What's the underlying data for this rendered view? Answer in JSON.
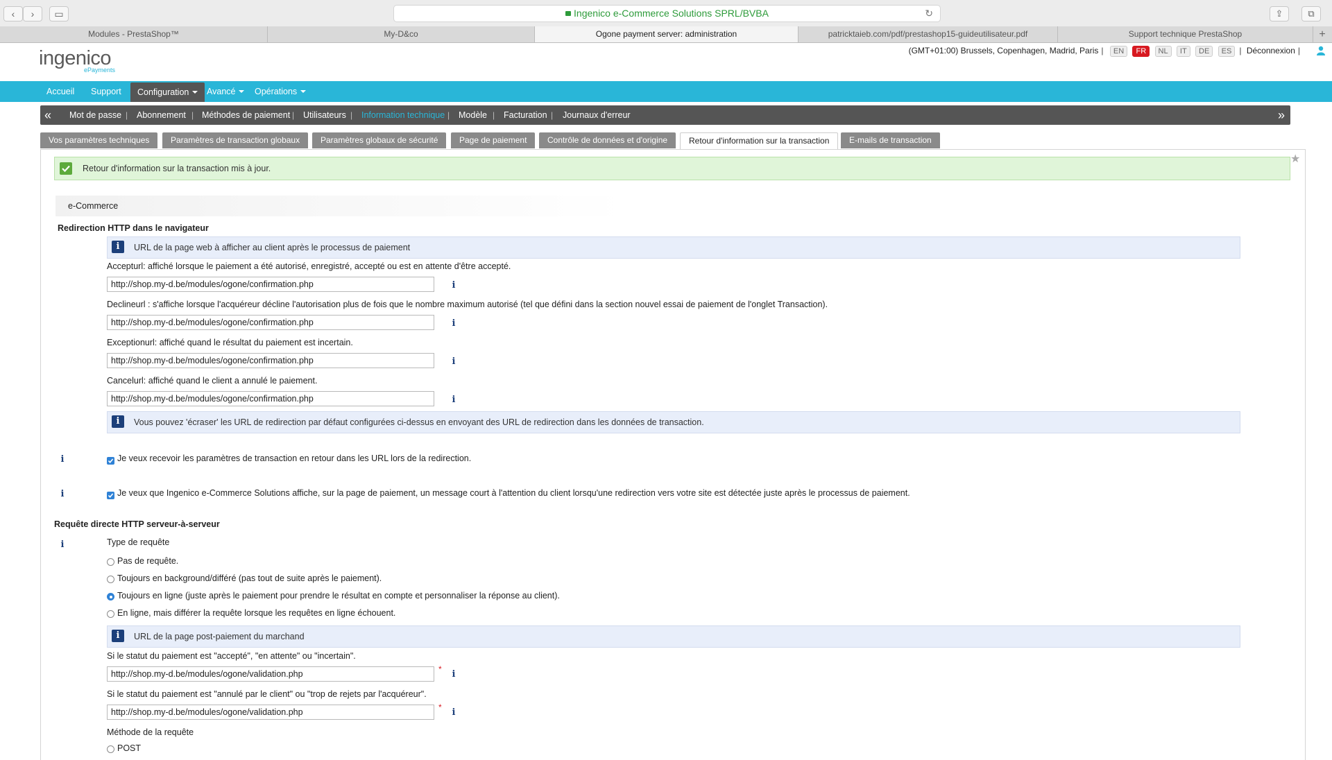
{
  "browser": {
    "url_text": "Ingenico e-Commerce Solutions SPRL/BVBA",
    "tabs": [
      {
        "label": "Modules - PrestaShop™"
      },
      {
        "label": "My-D&co"
      },
      {
        "label": "Ogone payment server: administration"
      },
      {
        "label": "patricktaieb.com/pdf/prestashop15-guideutilisateur.pdf"
      },
      {
        "label": "Support technique PrestaShop"
      }
    ],
    "new_tab": "+"
  },
  "header": {
    "logo_text": "ingenico",
    "logo_sub": "ePayments",
    "timezone": "(GMT+01:00) Brussels, Copenhagen, Madrid, Paris",
    "languages": [
      "EN",
      "FR",
      "NL",
      "IT",
      "DE",
      "ES"
    ],
    "active_language": "FR",
    "logout": "Déconnexion"
  },
  "mainmenu": {
    "items": [
      {
        "label": "Accueil"
      },
      {
        "label": "Support"
      },
      {
        "label": "Configuration"
      },
      {
        "label": "Avancé"
      },
      {
        "label": "Opérations"
      }
    ]
  },
  "submenu": {
    "items": [
      {
        "label": "Mot de passe"
      },
      {
        "label": "Abonnement"
      },
      {
        "label": "Méthodes de paiement"
      },
      {
        "label": "Utilisateurs"
      },
      {
        "label": "Information technique"
      },
      {
        "label": "Modèle"
      },
      {
        "label": "Facturation"
      },
      {
        "label": "Journaux d'erreur"
      }
    ]
  },
  "content_tabs": [
    {
      "label": "Vos paramètres techniques"
    },
    {
      "label": "Paramètres de transaction globaux"
    },
    {
      "label": "Paramètres globaux de sécurité"
    },
    {
      "label": "Page de paiement"
    },
    {
      "label": "Contrôle de données et d'origine"
    },
    {
      "label": "Retour d'information sur la transaction"
    },
    {
      "label": "E-mails de transaction"
    }
  ],
  "success_message": "Retour d'information sur la transaction mis à jour.",
  "section_title": "e-Commerce",
  "redirect": {
    "heading": "Redirection HTTP dans le navigateur",
    "info": "URL de la page web à afficher au client après le processus de paiement",
    "accept_label": "Accepturl: affiché lorsque le paiement a été autorisé, enregistré, accepté ou est en attente d'être accepté.",
    "accept_value": "http://shop.my-d.be/modules/ogone/confirmation.php",
    "decline_label": "Declineurl : s'affiche lorsque l'acquéreur décline l'autorisation plus de fois que le nombre maximum autorisé (tel que défini dans la section nouvel essai de paiement de l'onglet Transaction).",
    "decline_value": "http://shop.my-d.be/modules/ogone/confirmation.php",
    "exception_label": "Exceptionurl: affiché quand le résultat du paiement est incertain.",
    "exception_value": "http://shop.my-d.be/modules/ogone/confirmation.php",
    "cancel_label": "Cancelurl: affiché quand le client a annulé le paiement.",
    "cancel_value": "http://shop.my-d.be/modules/ogone/confirmation.php",
    "override_info": "Vous pouvez 'écraser' les URL de redirection par défaut configurées ci-dessus en envoyant des URL de redirection dans les données de transaction."
  },
  "options": {
    "receive_params": "Je veux recevoir les paramètres de transaction en retour dans les URL lors de la redirection.",
    "show_message": "Je veux que Ingenico e-Commerce Solutions affiche, sur la page de paiement, un message court à l'attention du client lorsqu'une redirection vers votre site est détectée juste après le processus de paiement."
  },
  "direct": {
    "heading": "Requête directe HTTP serveur-à-serveur",
    "type_label": "Type de requête",
    "radios": [
      {
        "label": "Pas de requête.",
        "checked": false
      },
      {
        "label": "Toujours en background/différé (pas tout de suite après le paiement).",
        "checked": false
      },
      {
        "label": "Toujours en ligne (juste après le paiement pour prendre le résultat en compte et personnaliser la réponse au client).",
        "checked": true
      },
      {
        "label": "En ligne, mais différer la requête lorsque les requêtes en ligne échouent.",
        "checked": false
      }
    ],
    "post_info": "URL de la page post-paiement du marchand",
    "status_ok_label": "Si le statut du paiement est \"accepté\", \"en attente\" ou \"incertain\".",
    "status_ok_value": "http://shop.my-d.be/modules/ogone/validation.php",
    "status_ko_label": "Si le statut du paiement est \"annulé par le client\" ou \"trop de rejets par l'acquéreur\".",
    "status_ko_value": "http://shop.my-d.be/modules/ogone/validation.php",
    "method_label": "Méthode de la requête",
    "method_option": "POST",
    "required_mark": "*"
  },
  "icons": {
    "info": "i"
  },
  "colors": {
    "accent": "#29b6d8",
    "submenu_bg": "#555555",
    "active_lang": "#d71920",
    "success_bg": "#e0f5d9",
    "info_bg": "#e8eefa"
  }
}
